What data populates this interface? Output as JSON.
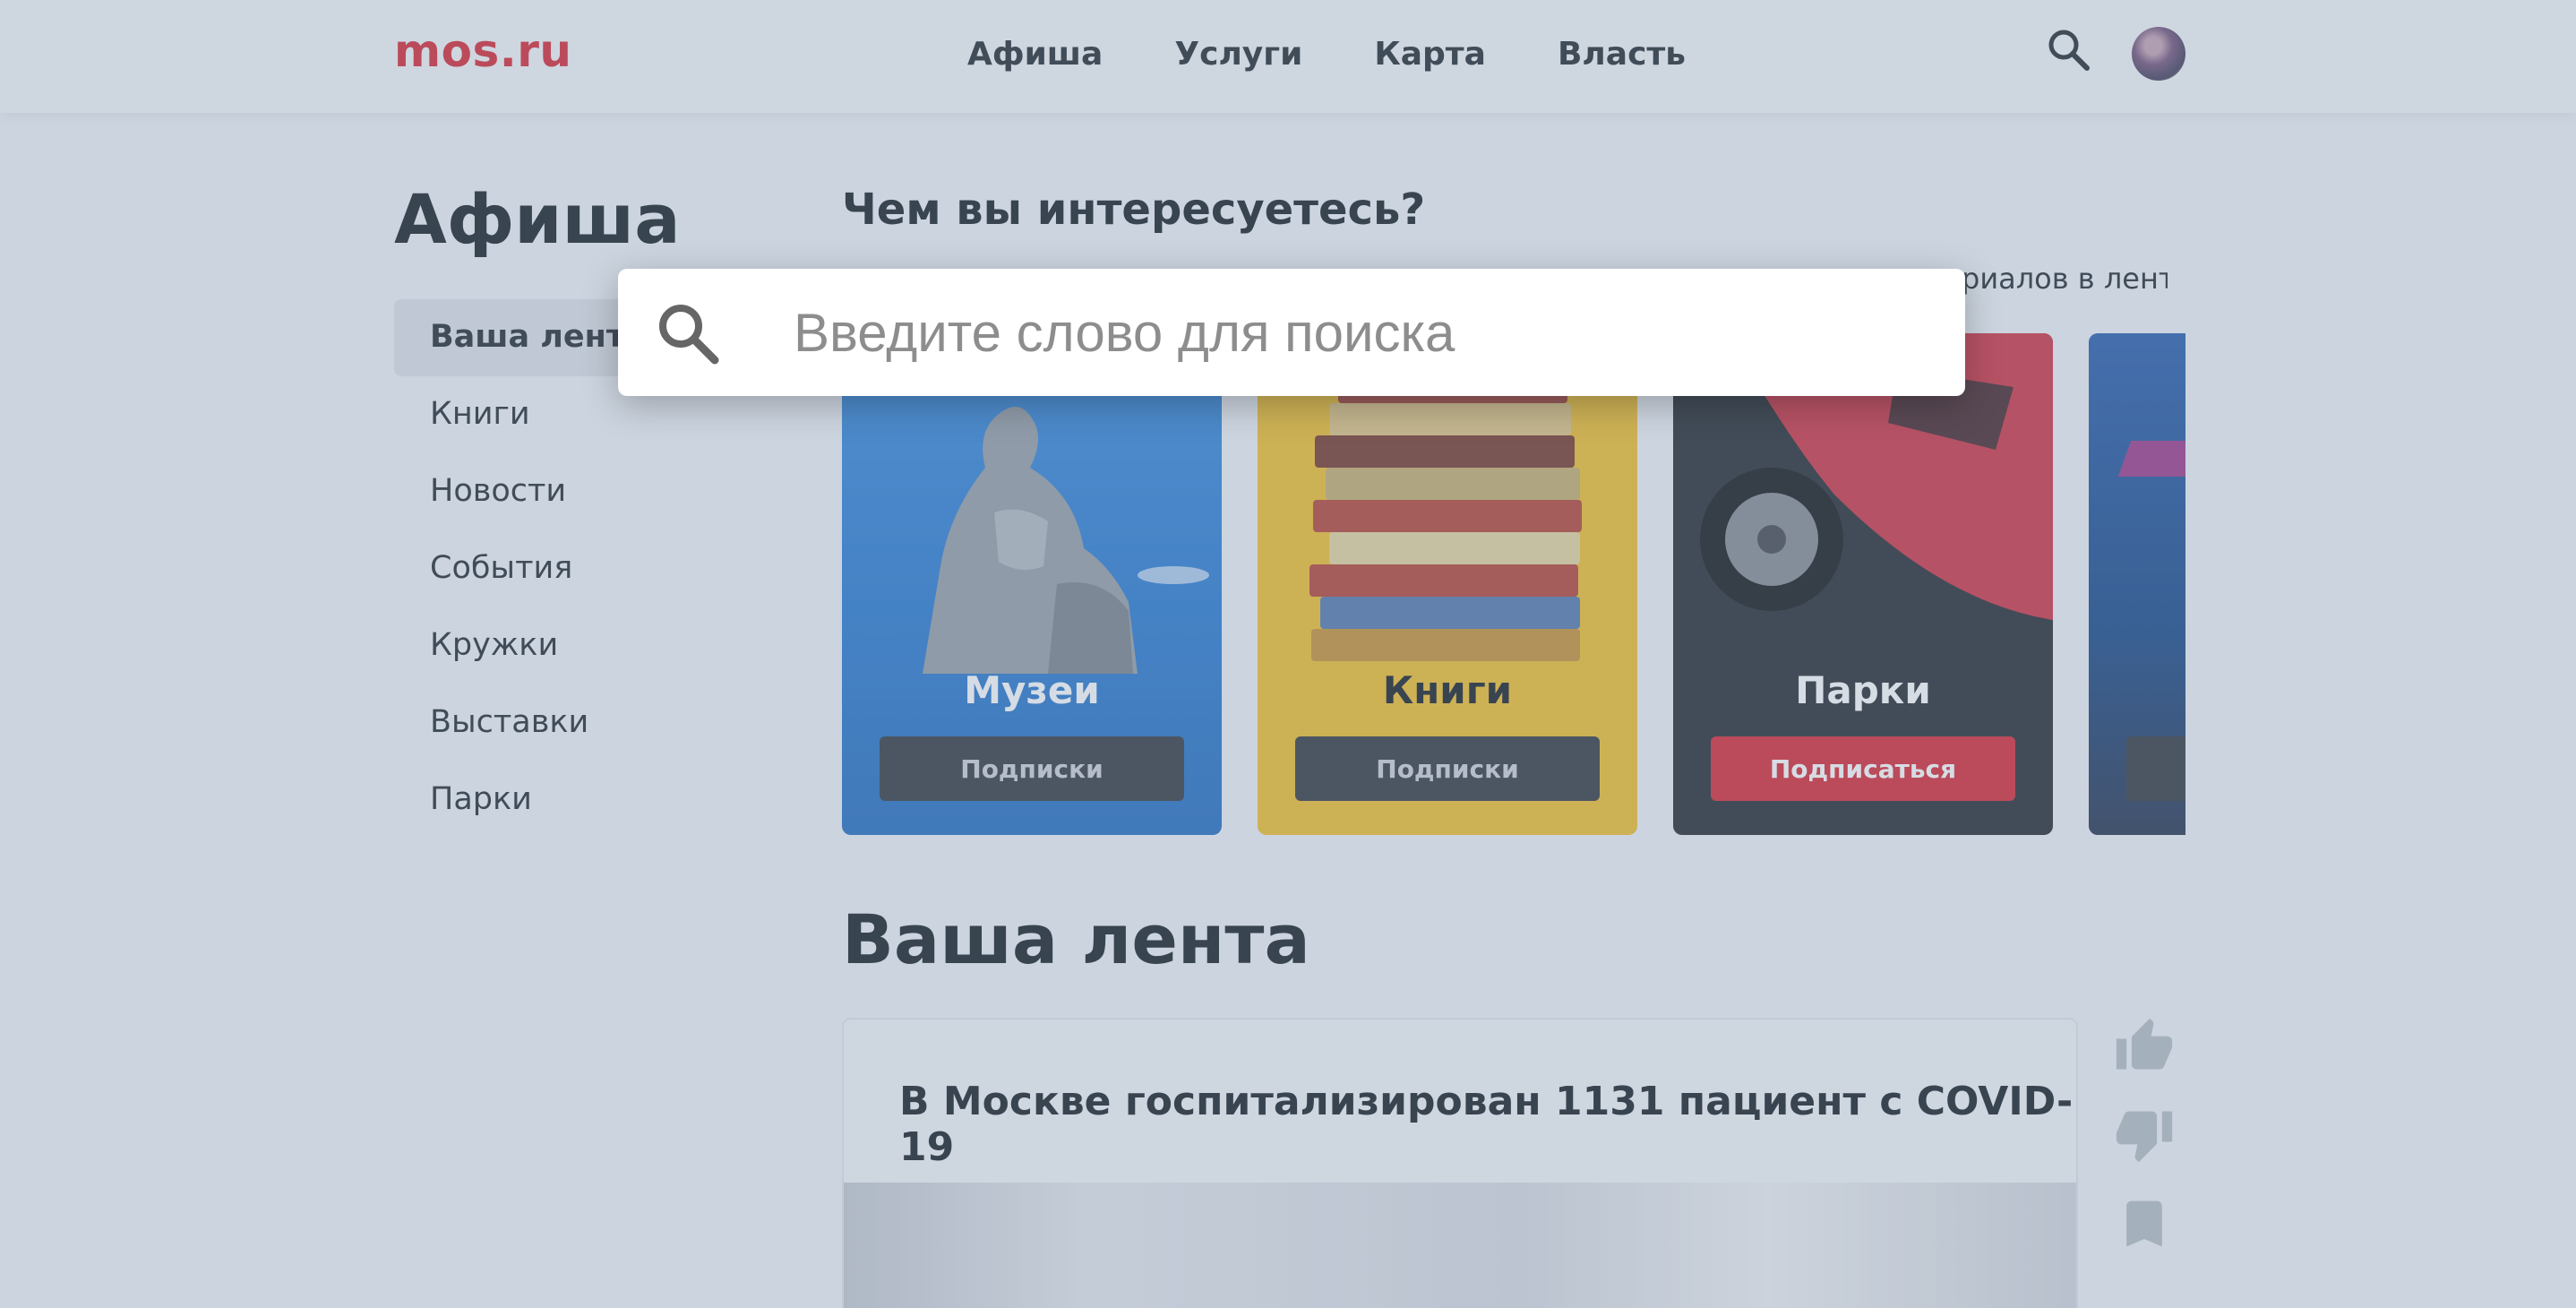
{
  "header": {
    "logo": "mos.ru",
    "nav": [
      "Афиша",
      "Услуги",
      "Карта",
      "Власть"
    ],
    "search_icon": "search-icon",
    "avatar": "user-avatar"
  },
  "sidebar": {
    "title": "Афиша",
    "items": [
      {
        "label": "Ваша лента",
        "active": true
      },
      {
        "label": "Книги"
      },
      {
        "label": "Новости"
      },
      {
        "label": "События"
      },
      {
        "label": "Кружки"
      },
      {
        "label": "Выставки"
      },
      {
        "label": "Парки"
      }
    ]
  },
  "main": {
    "question": "Чем вы интересуетесь?",
    "subtitle_visible": "риалов в ленту",
    "cards": [
      {
        "title": "Музеи",
        "button": "Подписки",
        "state": "subscribed",
        "color": "#2f7fd4"
      },
      {
        "title": "Книги",
        "button": "Подписки",
        "state": "subscribed",
        "color": "#f2c233"
      },
      {
        "title": "Парки",
        "button": "Подписаться",
        "state": "unsubscribed",
        "color": "#2c3137"
      },
      {
        "title": "",
        "button": "",
        "state": "partial",
        "color": "#1f4e8c"
      }
    ],
    "feed_title": "Ваша лента",
    "news": [
      {
        "title": "В Москве госпитализирован 1131 пациент с COVID-19"
      }
    ],
    "actions": [
      "like-icon",
      "dislike-icon",
      "bookmark-icon"
    ]
  },
  "search_overlay": {
    "placeholder": "Введите слово для поиска",
    "value": ""
  },
  "colors": {
    "brand": "#d8303a",
    "subscribe": "#d8303a",
    "subscribed_btn": "#3a3f45"
  }
}
